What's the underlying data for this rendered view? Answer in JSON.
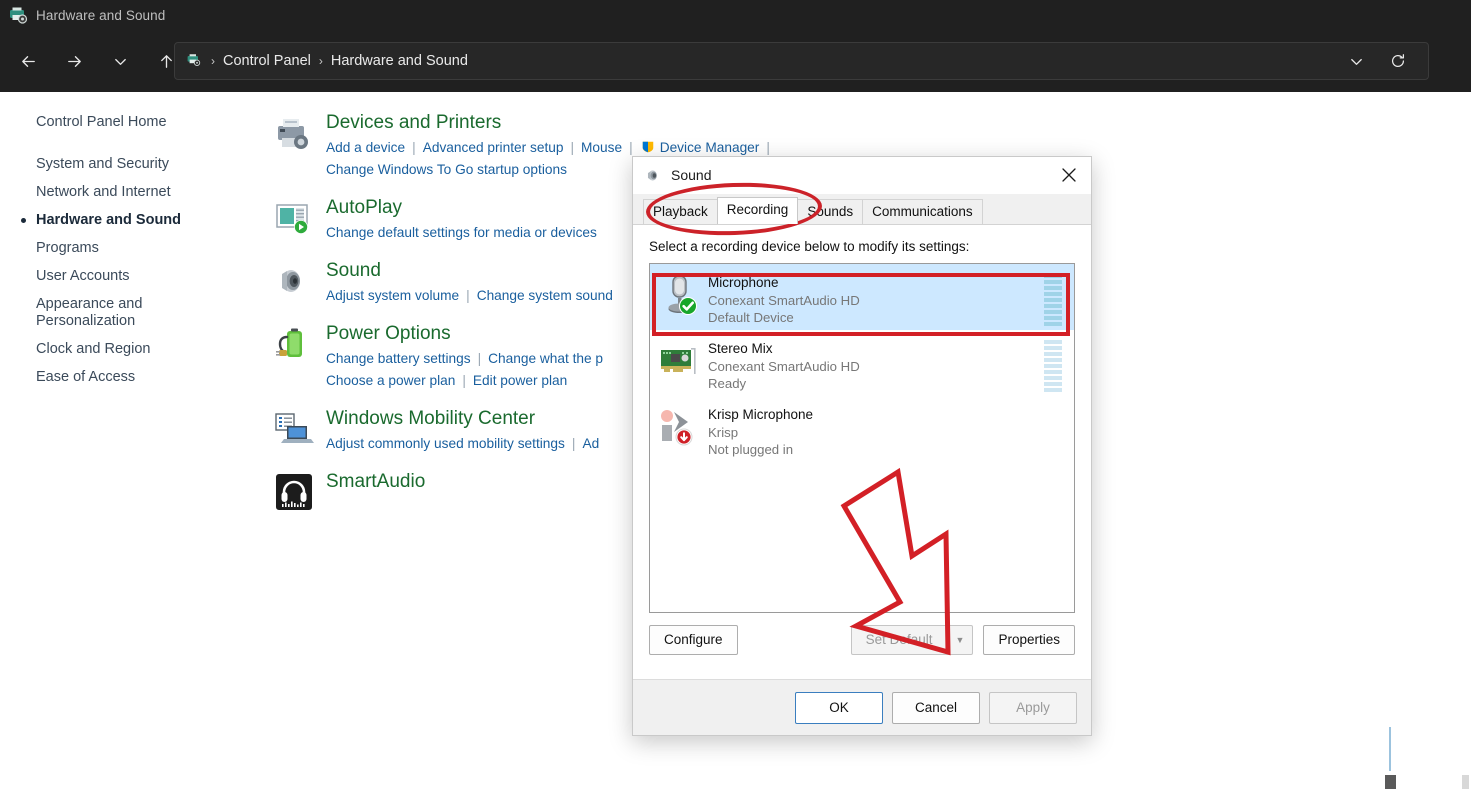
{
  "window": {
    "title": "Hardware and Sound",
    "title_icon": "devices-printers-icon",
    "nav": {
      "back": "back-arrow",
      "forward": "forward-arrow",
      "history": "chevron-down",
      "up": "up-arrow"
    },
    "address": {
      "icon": "devices-printers-icon",
      "crumbs": [
        "Control Panel",
        "Hardware and Sound"
      ],
      "separator": "›",
      "dropdown_icon": "chevron-down-icon",
      "refresh_icon": "refresh-icon"
    }
  },
  "sidebar": {
    "home": "Control Panel Home",
    "items": [
      {
        "label": "System and Security",
        "active": false
      },
      {
        "label": "Network and Internet",
        "active": false
      },
      {
        "label": "Hardware and Sound",
        "active": true
      },
      {
        "label": "Programs",
        "active": false
      },
      {
        "label": "User Accounts",
        "active": false
      },
      {
        "label": "Appearance and",
        "label2": "Personalization",
        "active": false
      },
      {
        "label": "Clock and Region",
        "active": false
      },
      {
        "label": "Ease of Access",
        "active": false
      }
    ]
  },
  "categories": [
    {
      "icon": "printer-icon",
      "title": "Devices and Printers",
      "rows": [
        [
          "Add a device",
          "Advanced printer setup",
          "Mouse",
          "Device Manager"
        ],
        [
          "Change Windows To Go startup options"
        ]
      ],
      "shield_on": "Device Manager"
    },
    {
      "icon": "autoplay-icon",
      "title": "AutoPlay",
      "rows": [
        [
          "Change default settings for media or devices"
        ]
      ]
    },
    {
      "icon": "speaker-icon",
      "title": "Sound",
      "rows": [
        [
          "Adjust system volume",
          "Change system sound"
        ]
      ]
    },
    {
      "icon": "battery-icon",
      "title": "Power Options",
      "rows": [
        [
          "Change battery settings",
          "Change what the p"
        ],
        [
          "Choose a power plan",
          "Edit power plan"
        ]
      ]
    },
    {
      "icon": "mobility-center-icon",
      "title": "Windows Mobility Center",
      "rows": [
        [
          "Adjust commonly used mobility settings",
          "Ad"
        ]
      ]
    },
    {
      "icon": "smartaudio-icon",
      "title": "SmartAudio",
      "rows": []
    }
  ],
  "dialog": {
    "title": "Sound",
    "title_icon": "speaker-icon",
    "close_icon": "close-icon",
    "tabs": [
      {
        "label": "Playback",
        "active": false
      },
      {
        "label": "Recording",
        "active": true
      },
      {
        "label": "Sounds",
        "active": false
      },
      {
        "label": "Communications",
        "active": false
      }
    ],
    "hint": "Select a recording device below to modify its settings:",
    "devices": [
      {
        "icon": "microphone-icon",
        "name": "Microphone",
        "driver": "Conexant SmartAudio HD",
        "status": "Default Device",
        "selected": true,
        "badge": "check-badge",
        "meter_active": true,
        "meter_bars": 9
      },
      {
        "icon": "sound-card-icon",
        "name": "Stereo Mix",
        "driver": "Conexant SmartAudio HD",
        "status": "Ready",
        "selected": false,
        "badge": "",
        "meter_active": false,
        "meter_bars": 9
      },
      {
        "icon": "krisp-icon",
        "name": "Krisp Microphone",
        "driver": "Krisp",
        "status": "Not plugged in",
        "selected": false,
        "badge": "down-arrow-badge",
        "meter_active": false,
        "meter_bars": 0
      }
    ],
    "buttons": {
      "configure": "Configure",
      "set_default": "Set Default",
      "set_default_caret": "▼",
      "properties": "Properties",
      "ok": "OK",
      "cancel": "Cancel",
      "apply": "Apply"
    }
  },
  "annotations": {
    "ellipse_target": "recording-tab",
    "rect_target": "microphone-device-row",
    "arrow_target": "properties-button",
    "color": "#d32026"
  }
}
